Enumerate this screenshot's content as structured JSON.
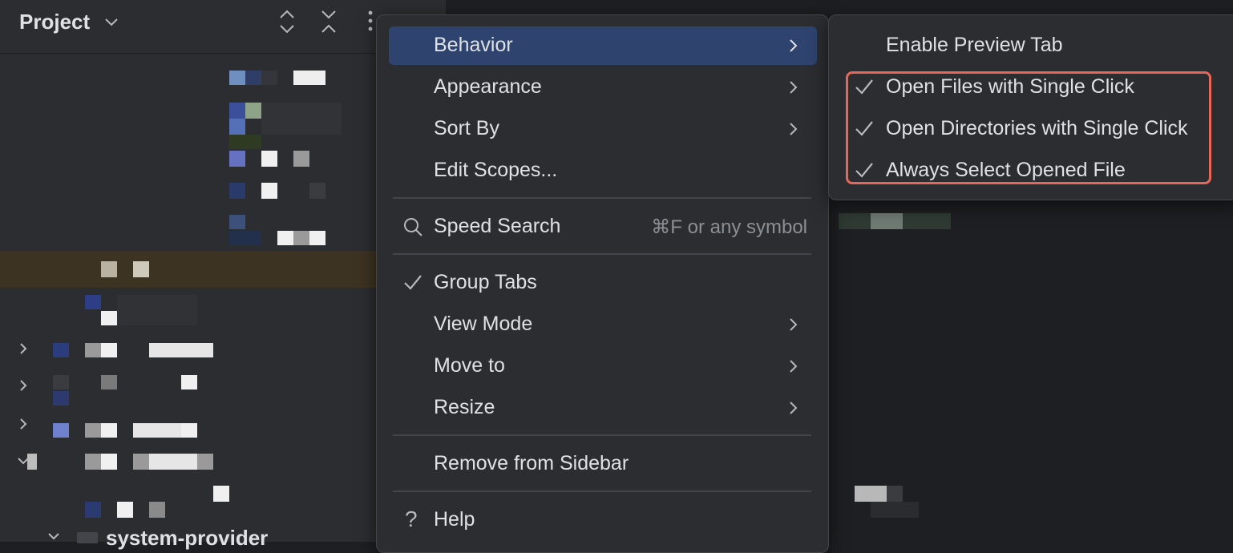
{
  "project_panel": {
    "title": "Project",
    "bottom_item_label": "system-provider"
  },
  "menu": {
    "items": [
      {
        "label": "Behavior",
        "submenu": true,
        "selected": true
      },
      {
        "label": "Appearance",
        "submenu": true
      },
      {
        "label": "Sort By",
        "submenu": true
      },
      {
        "label": "Edit Scopes..."
      },
      {
        "label": "Speed Search",
        "shortcut": "⌘F or any symbol",
        "icon": "search-icon"
      },
      {
        "label": "Group Tabs",
        "checked": true
      },
      {
        "label": "View Mode",
        "submenu": true
      },
      {
        "label": "Move to",
        "submenu": true
      },
      {
        "label": "Resize",
        "submenu": true
      },
      {
        "label": "Remove from Sidebar"
      },
      {
        "label": "Help",
        "icon": "help-icon",
        "icon_glyph": "?"
      }
    ]
  },
  "submenu": {
    "items": [
      {
        "label": "Enable Preview Tab",
        "checked": false
      },
      {
        "label": "Open Files with Single Click",
        "checked": true
      },
      {
        "label": "Open Directories with Single Click",
        "checked": true
      },
      {
        "label": "Always Select Opened File",
        "checked": true
      }
    ]
  },
  "colors": {
    "menu_bg": "#2b2d30",
    "selection": "#2e436e",
    "callout": "#e5675a",
    "text": "#dfe1e5",
    "shortcut_text": "#8c8f94"
  }
}
